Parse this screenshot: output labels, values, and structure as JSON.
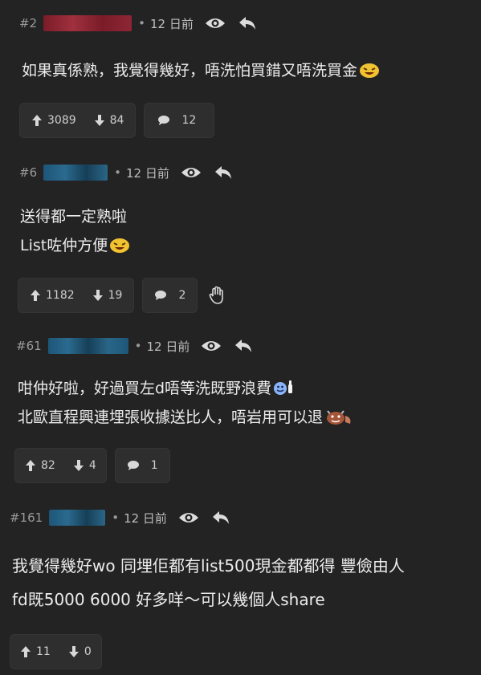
{
  "colors": {
    "background": "#232323",
    "pill": "#2e2e2e",
    "text": "#ececec",
    "meta": "#9a9a9a"
  },
  "posts": [
    {
      "number": "#2",
      "username_blur_color": "#8a1f2b",
      "dot": "•",
      "time": "12 日前",
      "lines": [
        "如果真係熟，我覺得幾好，唔洗怕買錯又唔洗買金"
      ],
      "emoji": "laughing-face",
      "upvotes": "3089",
      "downvotes": "84",
      "comments": "12"
    },
    {
      "number": "#6",
      "username_blur_color": "#1f5a7a",
      "dot": "•",
      "time": "12 日前",
      "lines": [
        "送得都一定熟啦",
        "List咗仲方便"
      ],
      "emoji": "laughing-face",
      "upvotes": "1182",
      "downvotes": "19",
      "comments": "2"
    },
    {
      "number": "#61",
      "username_blur_color": "#1f5a7a",
      "dot": "•",
      "time": "12 日前",
      "lines": [
        "咁仲好啦，好過買左d唔等洗既野浪費",
        "北歐直程興連埋張收據送比人，唔岩用可以退"
      ],
      "emoji": "thumbs-face",
      "emoji2": "devil-face",
      "upvotes": "82",
      "downvotes": "4",
      "comments": "1"
    },
    {
      "number": "#161",
      "username_blur_color": "#1f5a7a",
      "dot": "•",
      "time": "12 日前",
      "lines": [
        "我覺得幾好wo 同埋佢都有list500現金都都得 豐儉由人",
        "fd既5000 6000 好多咩～可以幾個人share"
      ],
      "upvotes": "11",
      "downvotes": "0"
    }
  ]
}
